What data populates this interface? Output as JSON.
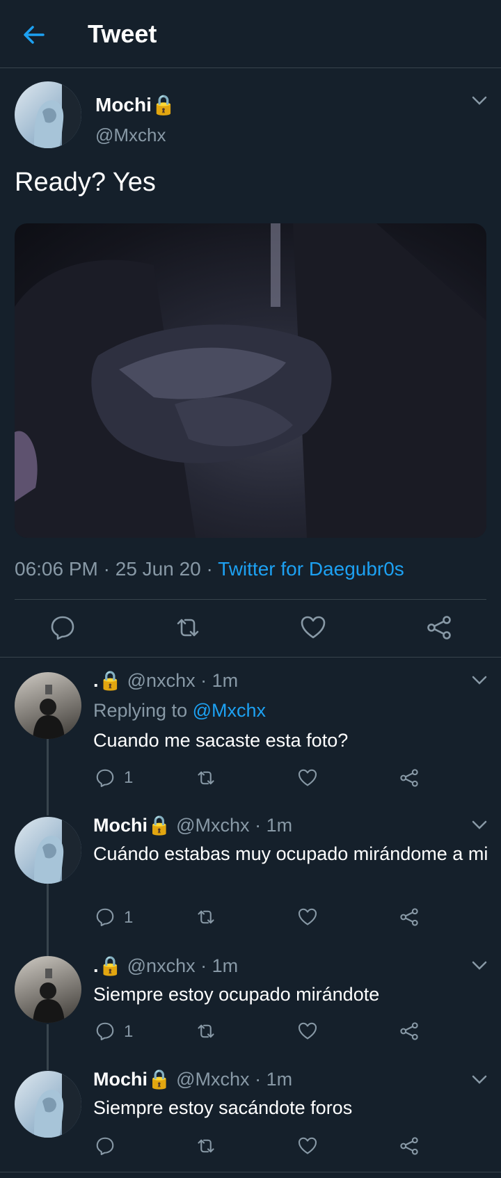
{
  "header": {
    "title": "Tweet"
  },
  "tweet": {
    "name": "Mochi🔒",
    "handle": "@Mxchx",
    "text": "Ready? Yes",
    "time": "06:06 PM",
    "date": "25 Jun 20",
    "source": "Twitter for Daegubr0s"
  },
  "replies": [
    {
      "name": ".🔒",
      "handle": "@nxchx",
      "time": "1m",
      "replying_label": "Replying to",
      "replying_to": "@Mxchx",
      "text": "Cuando me sacaste esta foto?",
      "reply_count": "1"
    },
    {
      "name": "Mochi🔒",
      "handle": "@Mxchx",
      "time": "1m",
      "text": "Cuándo estabas muy ocupado mirándome a mi",
      "reply_count": "1"
    },
    {
      "name": ".🔒",
      "handle": "@nxchx",
      "time": "1m",
      "text": "Siempre estoy ocupado mirándote",
      "reply_count": "1"
    },
    {
      "name": "Mochi🔒",
      "handle": "@Mxchx",
      "time": "1m",
      "text": "Siempre estoy sacándote foros",
      "reply_count": ""
    }
  ],
  "colors": {
    "background": "#15202b",
    "accent": "#1da1f2",
    "secondary_text": "#8899a6",
    "divider": "#38444d"
  },
  "icons": [
    "back-arrow-icon",
    "chevron-down-icon",
    "reply-icon",
    "retweet-icon",
    "like-icon",
    "share-icon"
  ]
}
